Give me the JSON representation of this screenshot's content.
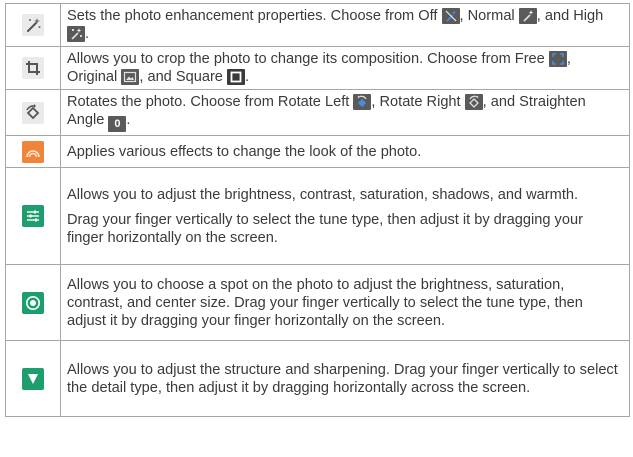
{
  "rows": [
    {
      "icon": "magic-wand-icon",
      "text": [
        {
          "t": "Sets the photo enhancement properties. Choose from Off "
        },
        {
          "icon": "enhance-off-icon"
        },
        {
          "t": ", Normal "
        },
        {
          "icon": "enhance-normal-icon"
        },
        {
          "t": ", and High "
        },
        {
          "icon": "enhance-high-icon"
        },
        {
          "t": "."
        }
      ]
    },
    {
      "icon": "crop-icon",
      "text": [
        {
          "t": "Allows you to crop the photo to change its composition. Choose from Free "
        },
        {
          "icon": "crop-free-icon"
        },
        {
          "t": ", Original "
        },
        {
          "icon": "crop-original-icon"
        },
        {
          "t": ", and Square "
        },
        {
          "icon": "crop-square-icon"
        },
        {
          "t": "."
        }
      ]
    },
    {
      "icon": "rotate-icon",
      "text": [
        {
          "t": "Rotates the photo. Choose from Rotate Left "
        },
        {
          "icon": "rotate-left-icon"
        },
        {
          "t": ", Rotate Right "
        },
        {
          "icon": "rotate-right-icon"
        },
        {
          "t": ", and Straighten Angle "
        },
        {
          "icon": "straighten-angle-icon"
        },
        {
          "t": "."
        }
      ]
    },
    {
      "icon": "effects-icon",
      "text": [
        {
          "t": "Applies various effects to change the look of the photo."
        }
      ]
    },
    {
      "icon": "tune-icon",
      "paras": [
        "Allows you to adjust the brightness, contrast, saturation, shadows, and warmth.",
        "Drag your finger vertically to select the tune type, then adjust it by dragging your finger horizontally on the screen."
      ]
    },
    {
      "icon": "selective-adjust-icon",
      "text": [
        {
          "t": "Allows you to choose a spot on the photo to adjust the brightness, saturation, contrast, and center size. Drag your finger vertically to select the tune type, then adjust it by dragging your finger horizontally on the screen."
        }
      ]
    },
    {
      "icon": "details-icon",
      "text": [
        {
          "t": "Allows you to adjust the structure and sharpening. Drag your finger vertically to select the detail type, then adjust it by dragging horizontally across the screen."
        }
      ]
    }
  ],
  "inline_icon_values": {
    "straighten_angle": "0"
  },
  "colors": {
    "border": "#a6a6a6",
    "text": "#3a3a3a",
    "green_icon": "#1e9e6c",
    "effects_orange": "#f0843a",
    "icon_bg_gray": "#eaeaea",
    "inline_icon_bg": "#5a5a5a"
  }
}
